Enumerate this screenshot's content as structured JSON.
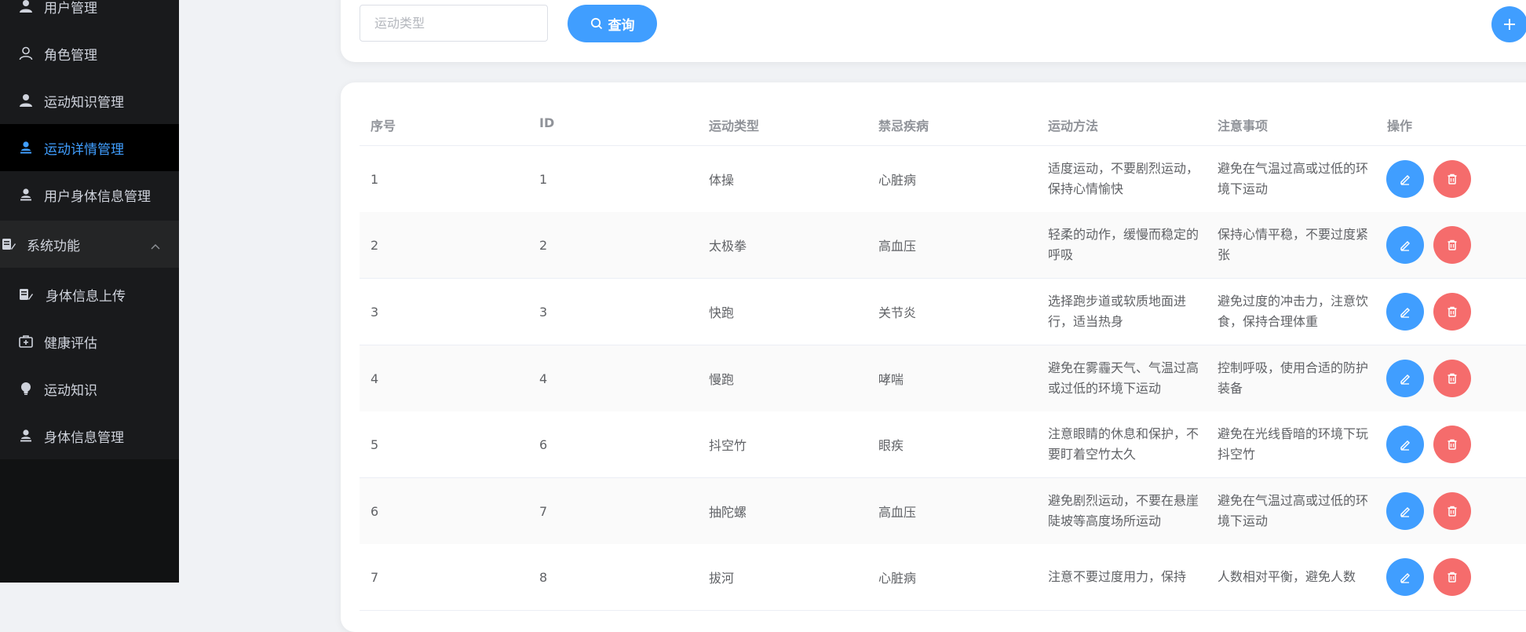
{
  "sidebar": {
    "items": [
      {
        "label": "用户管理",
        "icon": "user-filled-icon"
      },
      {
        "label": "角色管理",
        "icon": "user-outline-icon"
      },
      {
        "label": "运动知识管理",
        "icon": "user-filled-icon"
      },
      {
        "label": "运动详情管理",
        "icon": "user-stamp-icon",
        "active": true
      },
      {
        "label": "用户身体信息管理",
        "icon": "user-stamp-icon"
      }
    ],
    "group": {
      "label": "系统功能",
      "icon": "document-edit-icon",
      "expanded": true
    },
    "sub_items": [
      {
        "label": "身体信息上传",
        "icon": "document-edit-icon"
      },
      {
        "label": "健康评估",
        "icon": "first-aid-kit-icon"
      },
      {
        "label": "运动知识",
        "icon": "lightbulb-icon"
      },
      {
        "label": "身体信息管理",
        "icon": "user-stamp-icon"
      }
    ]
  },
  "search": {
    "placeholder": "运动类型",
    "query_label": "查询"
  },
  "table": {
    "columns": [
      "序号",
      "ID",
      "运动类型",
      "禁忌疾病",
      "运动方法",
      "注意事项",
      "操作"
    ],
    "rows": [
      {
        "index": "1",
        "id": "1",
        "type": "体操",
        "disease": "心脏病",
        "method": "适度运动，不要剧烈运动，保持心情愉快",
        "notes": "避免在气温过高或过低的环境下运动"
      },
      {
        "index": "2",
        "id": "2",
        "type": "太极拳",
        "disease": "高血压",
        "method": "轻柔的动作，缓慢而稳定的呼吸",
        "notes": "保持心情平稳，不要过度紧张"
      },
      {
        "index": "3",
        "id": "3",
        "type": "快跑",
        "disease": "关节炎",
        "method": "选择跑步道或软质地面进行，适当热身",
        "notes": "避免过度的冲击力，注意饮食，保持合理体重"
      },
      {
        "index": "4",
        "id": "4",
        "type": "慢跑",
        "disease": "哮喘",
        "method": "避免在雾霾天气、气温过高或过低的环境下运动",
        "notes": "控制呼吸，使用合适的防护装备"
      },
      {
        "index": "5",
        "id": "6",
        "type": "抖空竹",
        "disease": "眼疾",
        "method": "注意眼睛的休息和保护，不要盯着空竹太久",
        "notes": "避免在光线昏暗的环境下玩抖空竹"
      },
      {
        "index": "6",
        "id": "7",
        "type": "抽陀螺",
        "disease": "高血压",
        "method": "避免剧烈运动，不要在悬崖陡坡等高度场所运动",
        "notes": "避免在气温过高或过低的环境下运动"
      },
      {
        "index": "7",
        "id": "8",
        "type": "拔河",
        "disease": "心脏病",
        "method": "注意不要过度用力，保持",
        "notes": "人数相对平衡，避免人数"
      }
    ]
  },
  "colors": {
    "accent": "#409eff",
    "danger": "#f56c6c",
    "sidebar_bg": "#191a1c"
  }
}
